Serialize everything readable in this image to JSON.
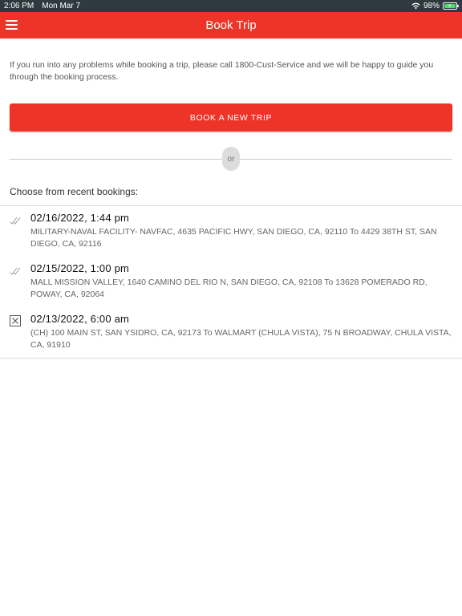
{
  "status_bar": {
    "time": "2:06 PM",
    "date": "Mon Mar 7",
    "battery": "98%",
    "icons": [
      "wifi-icon",
      "battery-charging-icon"
    ]
  },
  "header": {
    "title": "Book Trip",
    "menu_icon": "hamburger-menu-icon"
  },
  "intro": "If you run into any problems while booking a trip, please call 1800-Cust-Service and we will be happy to guide you through the booking process.",
  "book_button": "BOOK A NEW TRIP",
  "or_label": "or",
  "recent_label": "Choose from recent bookings:",
  "bookings": [
    {
      "date": "02/16/2022, 1:44 pm",
      "route": "MILITARY-NAVAL FACILITY- NAVFAC, 4635 PACIFIC HWY, SAN DIEGO, CA, 92110 To 4429 38TH ST, SAN DIEGO, CA, 92116",
      "status_icon": "double-check-icon"
    },
    {
      "date": "02/15/2022, 1:00 pm",
      "route": "MALL MISSION VALLEY, 1640 CAMINO DEL RIO N, SAN DIEGO, CA, 92108 To 13628 POMERADO RD, POWAY, CA, 92064",
      "status_icon": "double-check-icon"
    },
    {
      "date": "02/13/2022, 6:00 am",
      "route": "(CH) 100 MAIN ST, SAN YSIDRO, CA, 92173 To WALMART (CHULA VISTA), 75 N BROADWAY, CHULA VISTA, CA, 91910",
      "status_icon": "cancelled-box-icon"
    }
  ],
  "colors": {
    "accent": "#ee3428",
    "status_bar": "#2e3a40",
    "battery": "#4cd964"
  }
}
